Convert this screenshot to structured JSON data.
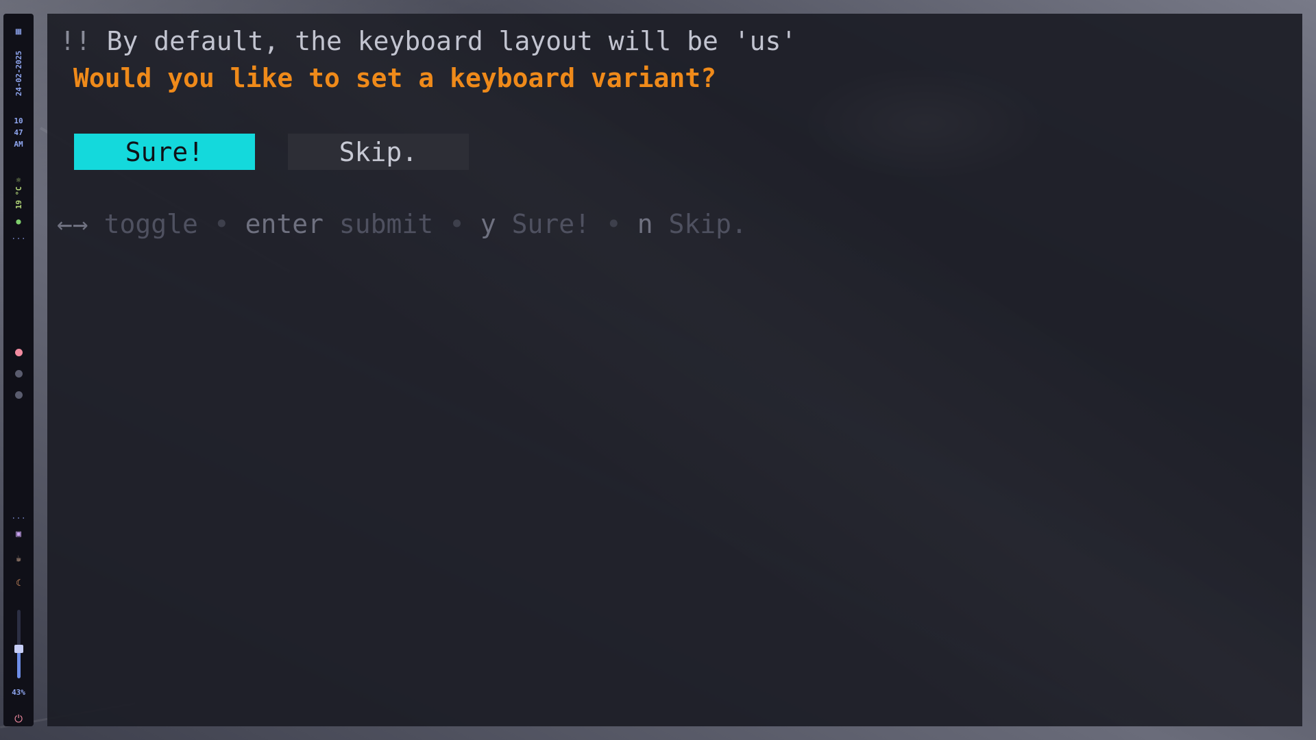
{
  "sidebar": {
    "workspaces_icon": "grid-icon",
    "date": "24-02-2025",
    "clock": {
      "hour": "10",
      "minute": "47",
      "ampm": "AM"
    },
    "weather": {
      "icon": "sun-icon",
      "temp": "19 °C"
    },
    "leaf_icon": "leaf-icon",
    "ellipsis": "...",
    "workspace_dots": [
      {
        "state": "active",
        "color": "#f18ba0"
      },
      {
        "state": "inactive",
        "color": "#5a5c6e"
      },
      {
        "state": "inactive",
        "color": "#5a5c6e"
      }
    ],
    "tray_ellipsis": "...",
    "tray_icons": [
      "network-icon",
      "coffee-icon",
      "night-light-icon"
    ],
    "brightness": {
      "value": 0.43,
      "label": "43%"
    },
    "power_icon": "power-icon"
  },
  "prompt": {
    "notice_prefix": "!!",
    "notice_text": "By default, the keyboard layout will be 'us'",
    "question": "Would you like to set a keyboard variant?",
    "buttons": [
      {
        "label": "Sure!",
        "selected": true
      },
      {
        "label": "Skip.",
        "selected": false
      }
    ],
    "help": [
      {
        "key": "←→",
        "desc": "toggle"
      },
      {
        "key": "enter",
        "desc": "submit"
      },
      {
        "key": "y",
        "desc": "Sure!"
      },
      {
        "key": "n",
        "desc": "Skip."
      }
    ],
    "help_separator": "•"
  },
  "colors": {
    "accent": "#14d9dc",
    "question": "#ef8a1a",
    "terminal_bg": "#1c1d26"
  }
}
